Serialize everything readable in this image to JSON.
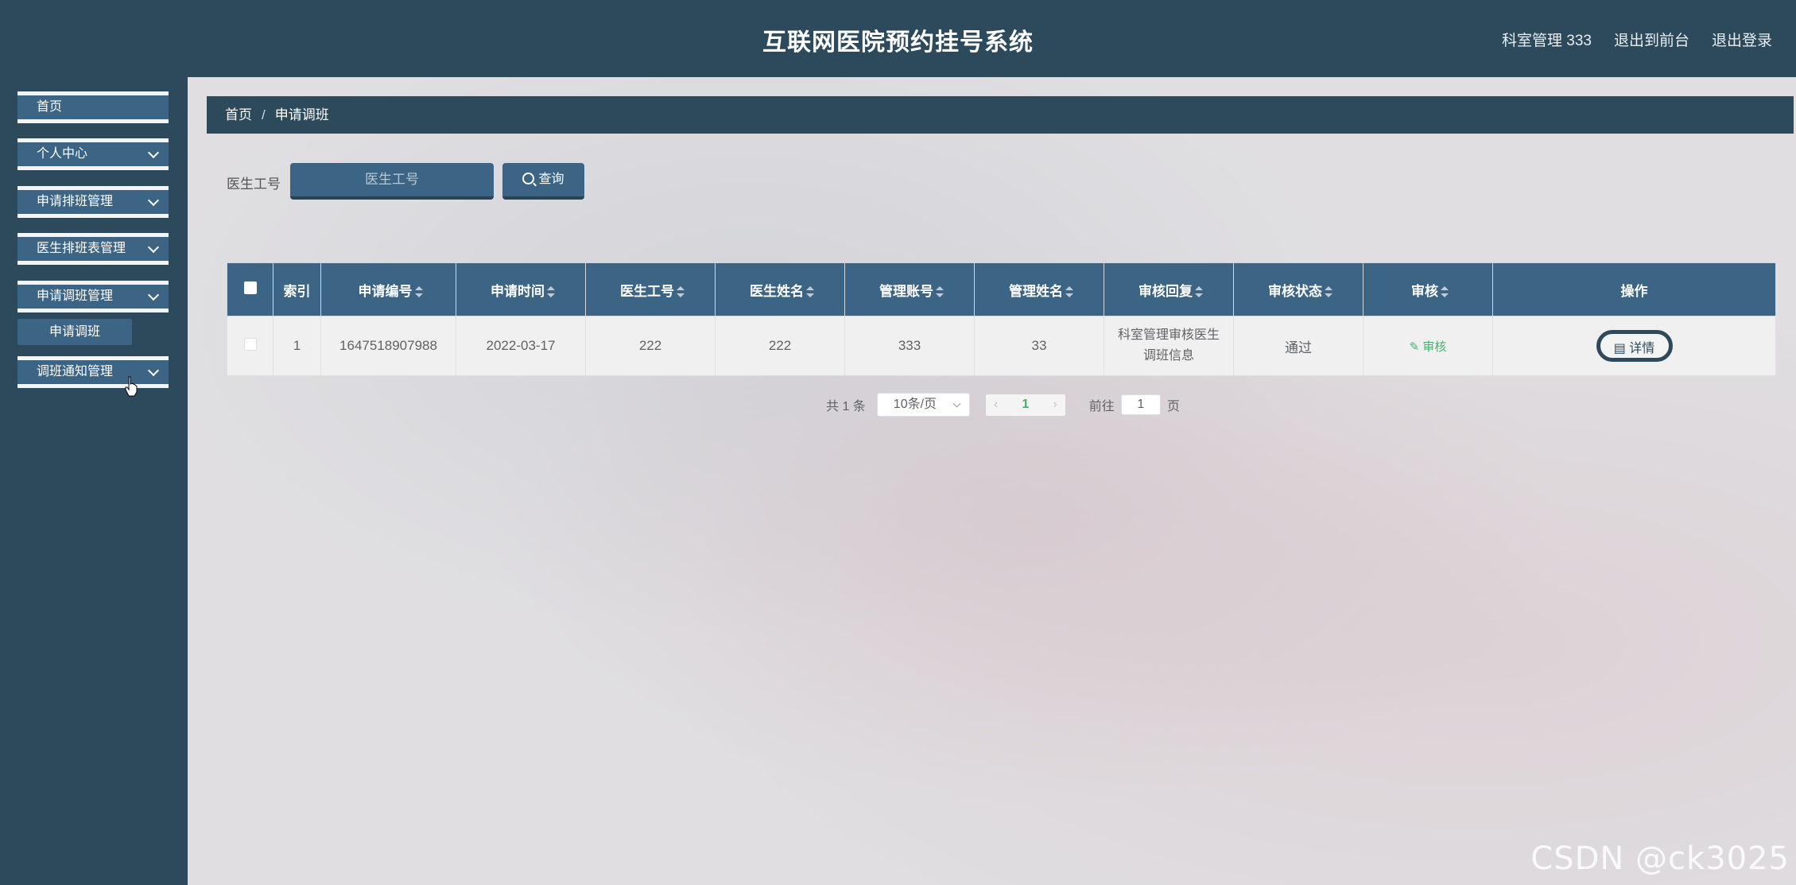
{
  "header": {
    "title": "互联网医院预约挂号系统",
    "user": "科室管理 333",
    "to_front": "退出到前台",
    "logout": "退出登录"
  },
  "sidebar": {
    "items": [
      {
        "label": "首页"
      },
      {
        "label": "个人中心"
      },
      {
        "label": "申请排班管理"
      },
      {
        "label": "医生排班表管理"
      },
      {
        "label": "申请调班管理"
      },
      {
        "label": "调班通知管理"
      }
    ],
    "submenu": {
      "label": "申请调班"
    }
  },
  "breadcrumb": {
    "home": "首页",
    "sep": "/",
    "current": "申请调班"
  },
  "search": {
    "label": "医生工号",
    "placeholder": "医生工号",
    "button": "查询"
  },
  "table": {
    "headers": [
      "索引",
      "申请编号",
      "申请时间",
      "医生工号",
      "医生姓名",
      "管理账号",
      "管理姓名",
      "审核回复",
      "审核状态",
      "审核",
      "操作"
    ],
    "rows": [
      {
        "index": "1",
        "apply_no": "1647518907988",
        "apply_time": "2022-03-17",
        "doctor_no": "222",
        "doctor_name": "222",
        "admin_account": "333",
        "admin_name": "33",
        "reply": "科室管理审核医生调班信息",
        "status": "通过",
        "audit": "审核",
        "detail": "详情"
      }
    ]
  },
  "pager": {
    "total": "共 1 条",
    "page_size": "10条/页",
    "current": "1",
    "goto_label": "前往",
    "goto_value": "1",
    "page_suffix": "页"
  },
  "watermark": "CSDN @ck3025",
  "colors": {
    "primary": "#3c6484",
    "dark": "#2d4a5c",
    "success": "#46b36b"
  }
}
